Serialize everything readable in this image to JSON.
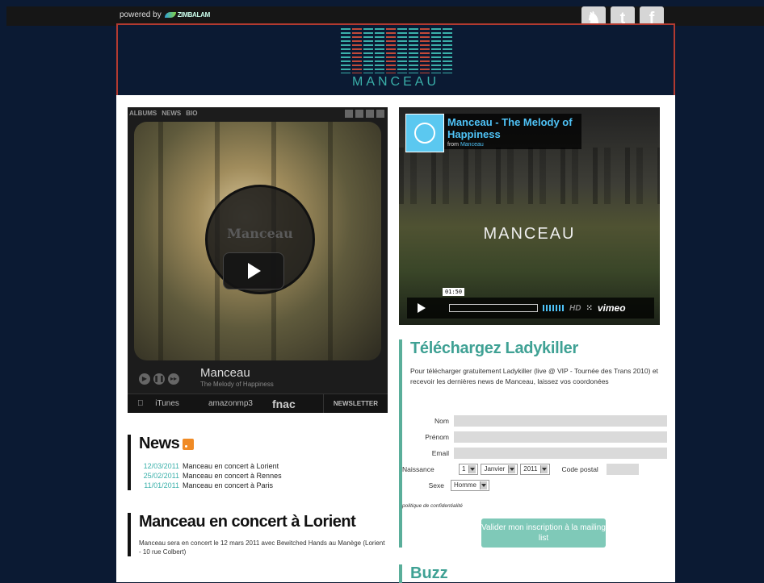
{
  "topbar": {
    "powered_by": "powered by",
    "brand": "ZIMBALAM",
    "social": [
      {
        "icon": "myspace-icon",
        "glyph": "♞"
      },
      {
        "icon": "twitter-icon",
        "glyph": "t"
      },
      {
        "icon": "facebook-icon",
        "glyph": "f"
      }
    ]
  },
  "header": {
    "logo_text": "MANCEAU"
  },
  "player": {
    "tabs": [
      "ALBUMS",
      "NEWS",
      "BIO"
    ],
    "badge_title": "Manceau",
    "artist": "Manceau",
    "track": "The Melody of Happiness",
    "stores": [
      "iTunes",
      "amazonmp3",
      "fnac"
    ],
    "newsletter": "NEWSLETTER"
  },
  "video": {
    "title": "Manceau - The Melody of Happiness",
    "from_label": "from",
    "from_author": "Manceau",
    "word": "MANCEAU",
    "time": "01:50",
    "hd": "HD",
    "brand": "vimeo"
  },
  "download": {
    "title": "Téléchargez Ladykiller",
    "text": "Pour télécharger gratuitement Ladykiller (live @ VIP - Tournée des Trans 2010) et recevoir les dernières news de Manceau, laissez vos coordonées",
    "labels": {
      "nom": "Nom",
      "prenom": "Prénom",
      "email": "Email",
      "naissance": "Naissance",
      "code_postal": "Code postal",
      "sexe": "Sexe"
    },
    "birth_day": "1",
    "birth_month": "Janvier",
    "birth_year": "2011",
    "sexe_value": "Homme",
    "privacy": "politique de confidentialité",
    "submit": "Valider mon inscription à la mailing list"
  },
  "news": {
    "title": "News",
    "items": [
      {
        "date": "12/03/2011",
        "text": "Manceau en concert à Lorient"
      },
      {
        "date": "25/02/2011",
        "text": "Manceau en concert à Rennes"
      },
      {
        "date": "11/01/2011",
        "text": "Manceau en concert à Paris"
      }
    ]
  },
  "article": {
    "title": "Manceau en concert à Lorient",
    "body": "Manceau sera en concert le 12 mars 2011 avec Bewitched Hands au Manège (Lorient - 10 rue Colbert)"
  },
  "buzz": {
    "title": "Buzz"
  },
  "colors": {
    "accent": "#3fa194",
    "header_border": "#b23a30",
    "background": "#0b1a33"
  }
}
